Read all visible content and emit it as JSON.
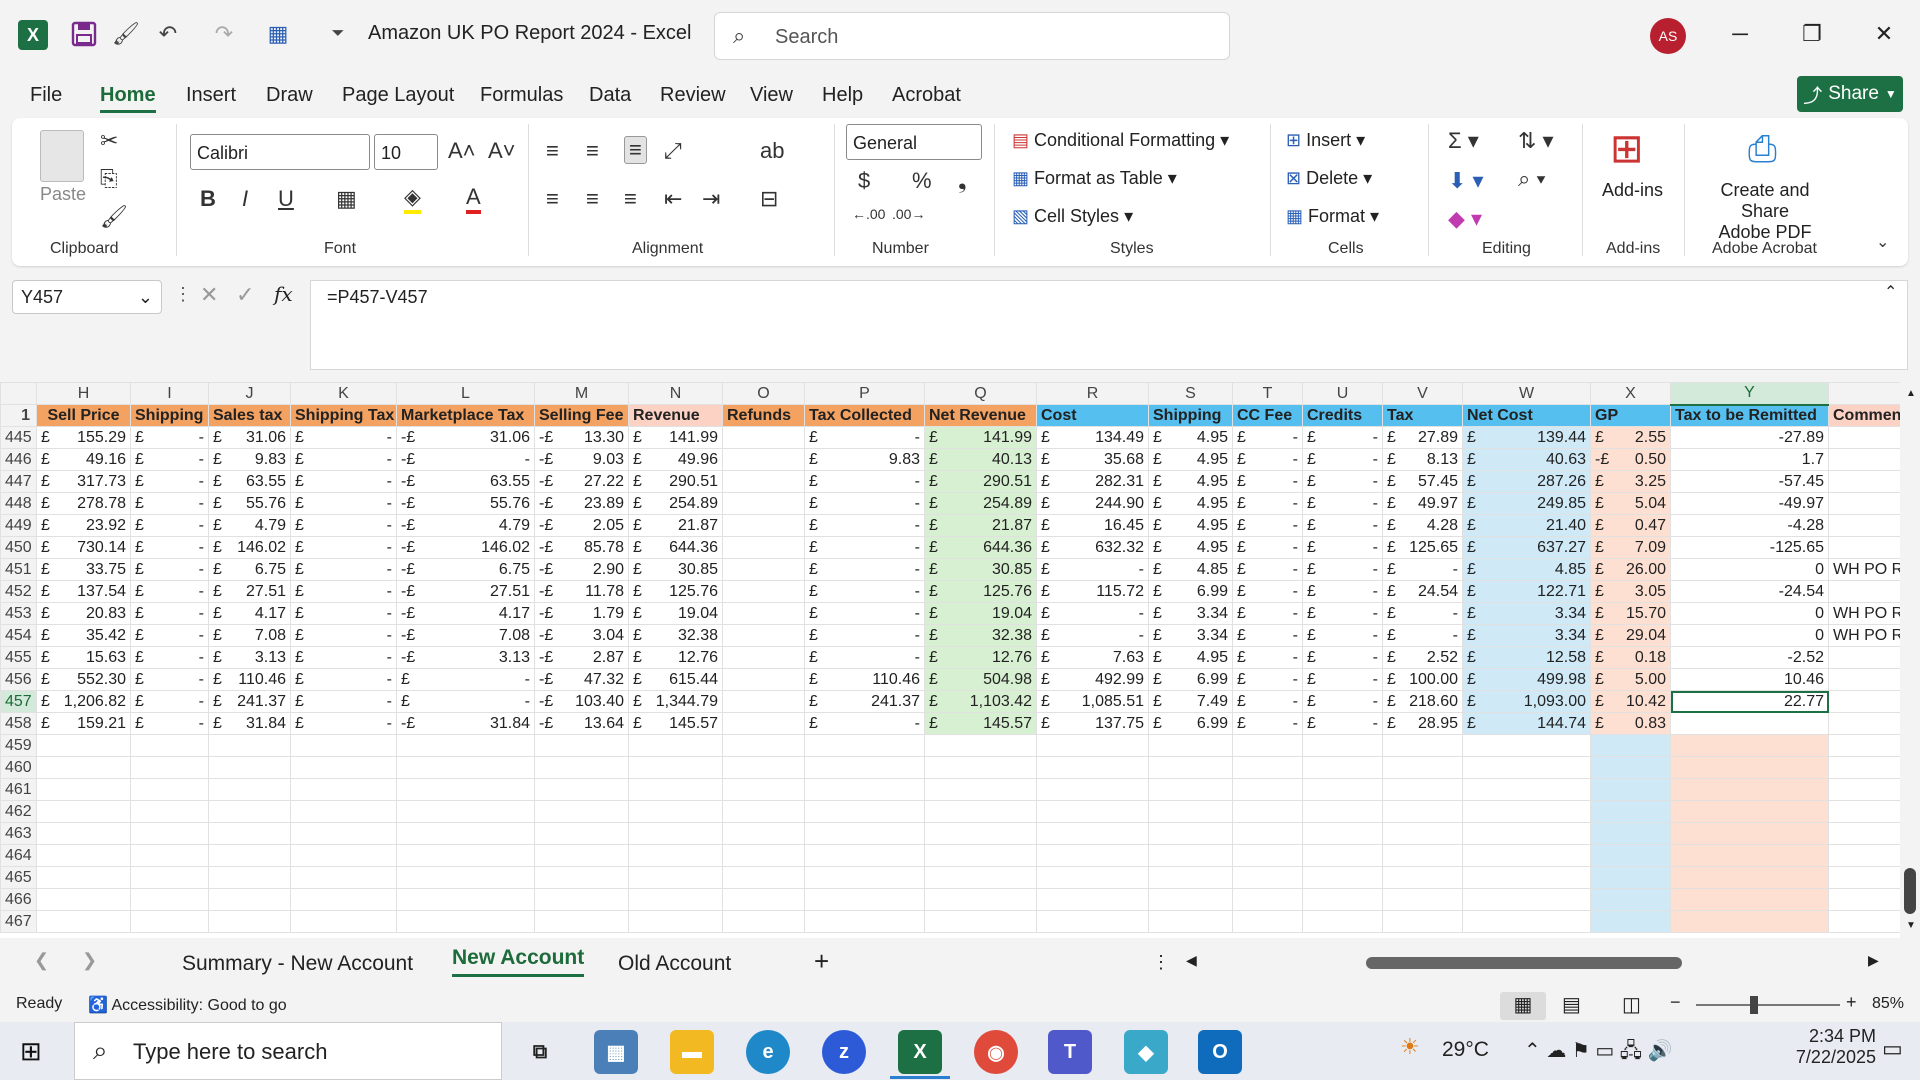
{
  "window": {
    "title": "Amazon UK PO Report 2024  -  Excel",
    "search_placeholder": "Search",
    "user_initials": "AS"
  },
  "menu": {
    "items": [
      "File",
      "Home",
      "Insert",
      "Draw",
      "Page Layout",
      "Formulas",
      "Data",
      "Review",
      "View",
      "Help",
      "Acrobat"
    ],
    "share": "Share"
  },
  "ribbon": {
    "clipboard": {
      "label": "Clipboard",
      "paste": "Paste"
    },
    "font": {
      "label": "Font",
      "family": "Calibri",
      "size": "10"
    },
    "alignment": {
      "label": "Alignment"
    },
    "number": {
      "label": "Number",
      "format": "General"
    },
    "styles": {
      "label": "Styles",
      "conditional": "Conditional Formatting",
      "table": "Format as Table",
      "cell_styles": "Cell Styles"
    },
    "cells": {
      "label": "Cells",
      "insert": "Insert",
      "delete": "Delete",
      "format": "Format"
    },
    "editing": {
      "label": "Editing"
    },
    "addins": {
      "label": "Add-ins",
      "button": "Add-ins"
    },
    "acrobat": {
      "label": "Adobe Acrobat",
      "button_line1": "Create and Share",
      "button_line2": "Adobe PDF"
    }
  },
  "formula_bar": {
    "name_box": "Y457",
    "formula": "=P457-V457"
  },
  "columns": [
    "H",
    "I",
    "J",
    "K",
    "L",
    "M",
    "N",
    "O",
    "P",
    "Q",
    "R",
    "S",
    "T",
    "U",
    "V",
    "W",
    "X",
    "Y"
  ],
  "header_row": {
    "row": "1",
    "cells": [
      "Sell Price",
      "Shipping",
      "Sales tax",
      "Shipping Tax",
      "Marketplace Tax",
      "Selling Fee",
      "Revenue",
      "Refunds",
      "Tax Collected",
      "Net Revenue",
      "Cost",
      "Shipping",
      "CC Fee",
      "Credits",
      "Tax",
      "Net Cost",
      "GP",
      "Tax to be Remitted",
      "Comments"
    ]
  },
  "rows": [
    {
      "n": "445",
      "c": [
        "£",
        "155.29",
        "£",
        "-",
        "£",
        "31.06",
        "£",
        "-",
        "-£",
        "31.06",
        "-£",
        "13.30",
        "£",
        "141.99",
        "",
        "£",
        "-",
        "£",
        "141.99",
        "£",
        "134.49",
        "£",
        "4.95",
        "£",
        "-",
        "£",
        "-",
        "£",
        "27.89",
        "£",
        "139.44",
        "£",
        "2.55",
        "-27.89",
        ""
      ]
    },
    {
      "n": "446",
      "c": [
        "£",
        "49.16",
        "£",
        "-",
        "£",
        "9.83",
        "£",
        "-",
        "-£",
        "-",
        "-£",
        "9.03",
        "£",
        "49.96",
        "",
        "£",
        "9.83",
        "£",
        "40.13",
        "£",
        "35.68",
        "£",
        "4.95",
        "£",
        "-",
        "£",
        "-",
        "£",
        "8.13",
        "£",
        "40.63",
        "-£",
        "0.50",
        "1.7",
        ""
      ]
    },
    {
      "n": "447",
      "c": [
        "£",
        "317.73",
        "£",
        "-",
        "£",
        "63.55",
        "£",
        "-",
        "-£",
        "63.55",
        "-£",
        "27.22",
        "£",
        "290.51",
        "",
        "£",
        "-",
        "£",
        "290.51",
        "£",
        "282.31",
        "£",
        "4.95",
        "£",
        "-",
        "£",
        "-",
        "£",
        "57.45",
        "£",
        "287.26",
        "£",
        "3.25",
        "-57.45",
        ""
      ]
    },
    {
      "n": "448",
      "c": [
        "£",
        "278.78",
        "£",
        "-",
        "£",
        "55.76",
        "£",
        "-",
        "-£",
        "55.76",
        "-£",
        "23.89",
        "£",
        "254.89",
        "",
        "£",
        "-",
        "£",
        "254.89",
        "£",
        "244.90",
        "£",
        "4.95",
        "£",
        "-",
        "£",
        "-",
        "£",
        "49.97",
        "£",
        "249.85",
        "£",
        "5.04",
        "-49.97",
        ""
      ]
    },
    {
      "n": "449",
      "c": [
        "£",
        "23.92",
        "£",
        "-",
        "£",
        "4.79",
        "£",
        "-",
        "-£",
        "4.79",
        "-£",
        "2.05",
        "£",
        "21.87",
        "",
        "£",
        "-",
        "£",
        "21.87",
        "£",
        "16.45",
        "£",
        "4.95",
        "£",
        "-",
        "£",
        "-",
        "£",
        "4.28",
        "£",
        "21.40",
        "£",
        "0.47",
        "-4.28",
        ""
      ]
    },
    {
      "n": "450",
      "c": [
        "£",
        "730.14",
        "£",
        "-",
        "£",
        "146.02",
        "£",
        "-",
        "-£",
        "146.02",
        "-£",
        "85.78",
        "£",
        "644.36",
        "",
        "£",
        "-",
        "£",
        "644.36",
        "£",
        "632.32",
        "£",
        "4.95",
        "£",
        "-",
        "£",
        "-",
        "£",
        "125.65",
        "£",
        "637.27",
        "£",
        "7.09",
        "-125.65",
        ""
      ]
    },
    {
      "n": "451",
      "c": [
        "£",
        "33.75",
        "£",
        "-",
        "£",
        "6.75",
        "£",
        "-",
        "-£",
        "6.75",
        "-£",
        "2.90",
        "£",
        "30.85",
        "",
        "£",
        "-",
        "£",
        "30.85",
        "£",
        "-",
        "£",
        "4.85",
        "£",
        "-",
        "£",
        "-",
        "£",
        "-",
        "£",
        "4.85",
        "£",
        "26.00",
        "0",
        "WH PO Resold"
      ]
    },
    {
      "n": "452",
      "c": [
        "£",
        "137.54",
        "£",
        "-",
        "£",
        "27.51",
        "£",
        "-",
        "-£",
        "27.51",
        "-£",
        "11.78",
        "£",
        "125.76",
        "",
        "£",
        "-",
        "£",
        "125.76",
        "£",
        "115.72",
        "£",
        "6.99",
        "£",
        "-",
        "£",
        "-",
        "£",
        "24.54",
        "£",
        "122.71",
        "£",
        "3.05",
        "-24.54",
        ""
      ]
    },
    {
      "n": "453",
      "c": [
        "£",
        "20.83",
        "£",
        "-",
        "£",
        "4.17",
        "£",
        "-",
        "-£",
        "4.17",
        "-£",
        "1.79",
        "£",
        "19.04",
        "",
        "£",
        "-",
        "£",
        "19.04",
        "£",
        "-",
        "£",
        "3.34",
        "£",
        "-",
        "£",
        "-",
        "£",
        "-",
        "£",
        "3.34",
        "£",
        "15.70",
        "0",
        "WH PO Resold"
      ]
    },
    {
      "n": "454",
      "c": [
        "£",
        "35.42",
        "£",
        "-",
        "£",
        "7.08",
        "£",
        "-",
        "-£",
        "7.08",
        "-£",
        "3.04",
        "£",
        "32.38",
        "",
        "£",
        "-",
        "£",
        "32.38",
        "£",
        "-",
        "£",
        "3.34",
        "£",
        "-",
        "£",
        "-",
        "£",
        "-",
        "£",
        "3.34",
        "£",
        "29.04",
        "0",
        "WH PO Resold"
      ]
    },
    {
      "n": "455",
      "c": [
        "£",
        "15.63",
        "£",
        "-",
        "£",
        "3.13",
        "£",
        "-",
        "-£",
        "3.13",
        "-£",
        "2.87",
        "£",
        "12.76",
        "",
        "£",
        "-",
        "£",
        "12.76",
        "£",
        "7.63",
        "£",
        "4.95",
        "£",
        "-",
        "£",
        "-",
        "£",
        "2.52",
        "£",
        "12.58",
        "£",
        "0.18",
        "-2.52",
        ""
      ]
    },
    {
      "n": "456",
      "c": [
        "£",
        "552.30",
        "£",
        "-",
        "£",
        "110.46",
        "£",
        "-",
        "£",
        "-",
        "-£",
        "47.32",
        "£",
        "615.44",
        "",
        "£",
        "110.46",
        "£",
        "504.98",
        "£",
        "492.99",
        "£",
        "6.99",
        "£",
        "-",
        "£",
        "-",
        "£",
        "100.00",
        "£",
        "499.98",
        "£",
        "5.00",
        "10.46",
        ""
      ]
    },
    {
      "n": "457",
      "c": [
        "£",
        "1,206.82",
        "£",
        "-",
        "£",
        "241.37",
        "£",
        "-",
        "£",
        "-",
        "-£",
        "103.40",
        "£",
        "1,344.79",
        "",
        "£",
        "241.37",
        "£",
        "1,103.42",
        "£",
        "1,085.51",
        "£",
        "7.49",
        "£",
        "-",
        "£",
        "-",
        "£",
        "218.60",
        "£",
        "1,093.00",
        "£",
        "10.42",
        "22.77",
        ""
      ]
    },
    {
      "n": "458",
      "c": [
        "£",
        "159.21",
        "£",
        "-",
        "£",
        "31.84",
        "£",
        "-",
        "-£",
        "31.84",
        "-£",
        "13.64",
        "£",
        "145.57",
        "",
        "£",
        "-",
        "£",
        "145.57",
        "£",
        "137.75",
        "£",
        "6.99",
        "£",
        "-",
        "£",
        "-",
        "£",
        "28.95",
        "£",
        "144.74",
        "£",
        "0.83",
        "",
        ""
      ]
    }
  ],
  "empty_rows": [
    "459",
    "460",
    "461",
    "462",
    "463",
    "464",
    "465",
    "466",
    "467"
  ],
  "sheets": [
    "Summary - New Account",
    "New Account",
    "Old Account"
  ],
  "status": {
    "ready": "Ready",
    "accessibility": "Accessibility: Good to go",
    "zoom": "85%"
  },
  "taskbar": {
    "search": "Type here to search",
    "weather": "29°C",
    "time": "2:34 PM",
    "date": "7/22/2025"
  }
}
